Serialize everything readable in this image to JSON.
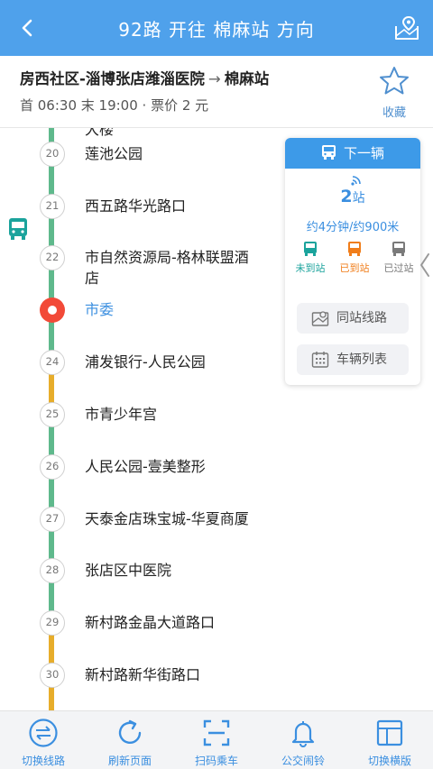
{
  "header": {
    "title": "92路 开往 棉麻站 方向"
  },
  "route_info": {
    "from": "房西社区-淄博张店潍淄医院",
    "arrow": "→",
    "to": "棉麻站",
    "times": "首 06:30 末 19:00 · 票价 2 元",
    "favorite_label": "收藏"
  },
  "stops": {
    "partial_top": "大楼",
    "items": [
      {
        "num": "20",
        "name": "莲池公园"
      },
      {
        "num": "21",
        "name": "西五路华光路口"
      },
      {
        "num": "22",
        "name": "市自然资源局-格林联盟酒店"
      },
      {
        "num": "",
        "name": "市委"
      },
      {
        "num": "24",
        "name": "浦发银行-人民公园"
      },
      {
        "num": "25",
        "name": "市青少年宫"
      },
      {
        "num": "26",
        "name": "人民公园-壹美整形"
      },
      {
        "num": "27",
        "name": "天泰金店珠宝城-华夏商厦"
      },
      {
        "num": "28",
        "name": "张店区中医院"
      },
      {
        "num": "29",
        "name": "新村路金晶大道路口"
      },
      {
        "num": "30",
        "name": "新村路新华街路口"
      }
    ]
  },
  "panel": {
    "title": "下一辆",
    "stops_count": "2",
    "stops_unit": "站",
    "eta": "约4分钟/约900米",
    "legend": [
      {
        "label": "未到站",
        "color": "#1ba39c"
      },
      {
        "label": "已到站",
        "color": "#f07d1a"
      },
      {
        "label": "已过站",
        "color": "#7a7a7a"
      }
    ],
    "same_station_lines": "同站线路",
    "vehicle_list": "车辆列表"
  },
  "bottom_nav": [
    {
      "label": "切换线路",
      "icon": "switch-route-icon"
    },
    {
      "label": "刷新页面",
      "icon": "refresh-icon"
    },
    {
      "label": "扫码乘车",
      "icon": "scan-icon"
    },
    {
      "label": "公交闹铃",
      "icon": "bell-icon"
    },
    {
      "label": "切换横版",
      "icon": "layout-icon"
    }
  ],
  "colors": {
    "header": "#4fa1eb",
    "line_green": "#5fb98c",
    "line_yellow": "#e7ad2b",
    "current_stop": "#f24a38",
    "accent": "#3b8fe0"
  }
}
